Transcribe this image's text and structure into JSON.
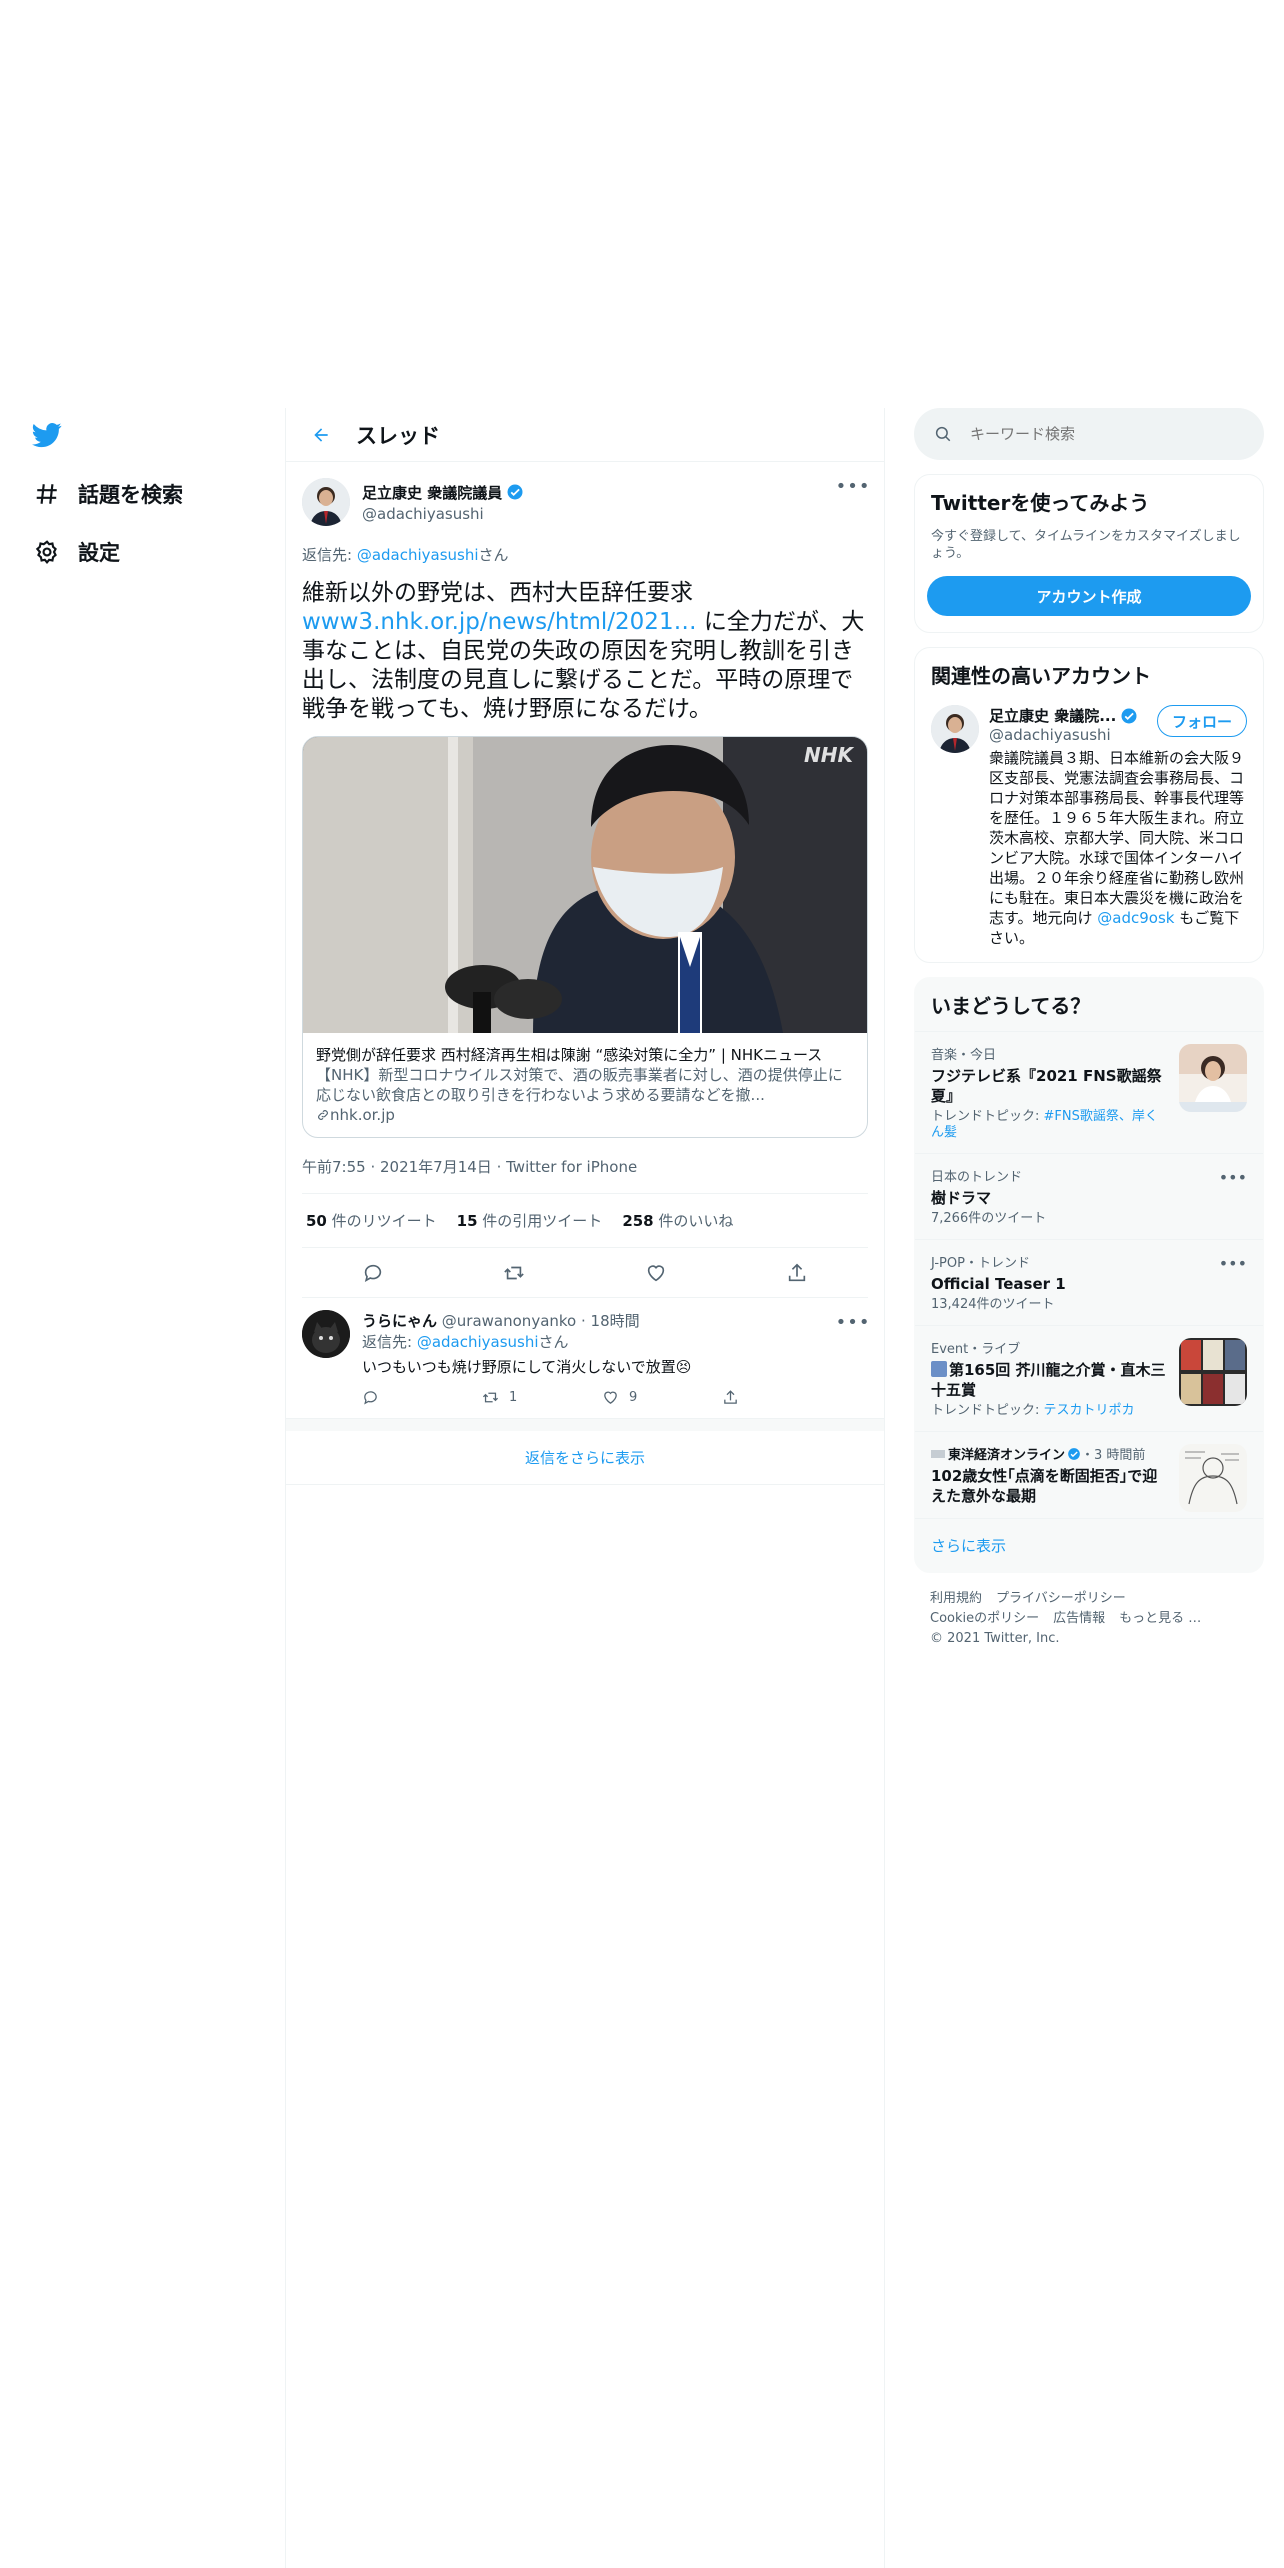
{
  "nav": {
    "explore_label": "話題を検索",
    "settings_label": "設定"
  },
  "header": {
    "title": "スレッド"
  },
  "tweet": {
    "author_name": "足立康史 衆議院議員",
    "author_handle": "@adachiyasushi",
    "reply_prefix": "返信先: ",
    "reply_handle": "@adachiyasushi",
    "reply_suffix": "さん",
    "text_before_link": "維新以外の野党は、西村大臣辞任要求",
    "link_text": "www3.nhk.or.jp/news/html/2021…",
    "text_after_link": " に全力だが、大事なことは、自民党の失政の原因を究明し教訓を引き出し、法制度の見直しに繋げることだ。平時の原理で戦争を戦っても、焼け野原になるだけ。",
    "card": {
      "title": "野党側が辞任要求 西村経済再生相は陳謝 “感染対策に全力” | NHKニュース",
      "description": "【NHK】新型コロナウイルス対策で、酒の販売事業者に対し、酒の提供停止に応じない飲食店との取り引きを行わないよう求める要請などを撤...",
      "domain": "nhk.or.jp",
      "watermark": "NHK"
    },
    "time": "午前7:55",
    "date": "2021年7月14日",
    "source": "Twitter for iPhone",
    "retweets_count": "50",
    "retweets_label": " 件のリツイート",
    "quotes_count": "15",
    "quotes_label": " 件の引用ツイート",
    "likes_count": "258",
    "likes_label": " 件のいいね"
  },
  "reply": {
    "name": "うらにゃん",
    "handle": "@urawanonyanko",
    "time": "18時間",
    "reply_prefix": "返信先: ",
    "reply_handle": "@adachiyasushi",
    "reply_suffix": "さん",
    "text": "いつもいつも焼け野原にして消火しないで放置😣",
    "retweet_count": "1",
    "like_count": "9"
  },
  "more_replies_label": "返信をさらに表示",
  "search": {
    "placeholder": "キーワード検索"
  },
  "signup": {
    "title": "Twitterを使ってみよう",
    "subtitle": "今すぐ登録して、タイムラインをカスタマイズしましょう。",
    "button": "アカウント作成"
  },
  "related": {
    "title": "関連性の高いアカウント",
    "name": "足立康史 衆議院...",
    "handle": "@adachiyasushi",
    "follow_label": "フォロー",
    "bio_before": "衆議院議員３期、日本維新の会大阪９区支部長、党憲法調査会事務局長、コロナ対策本部事務局長、幹事長代理等を歴任。１９６５年大阪生まれ。府立茨木高校、京都大学、同大院、米コロンビア大院。水球で国体インターハイ出場。２０年余り経産省に勤務し欧州にも駐在。東日本大震災を機に政治を志す。地元向け ",
    "bio_link": "@adc9osk",
    "bio_after": " もご覧下さい。"
  },
  "trends": {
    "title": "いまどうしてる？",
    "items": [
      {
        "category": "音楽・今日",
        "name": "フジテレビ系『2021 FNS歌謡祭 夏』",
        "sub_prefix": "トレンドトピック: ",
        "sub_link": "#FNS歌謡祭、岸くん髪"
      },
      {
        "category": "日本のトレンド",
        "name": "樹ドラマ",
        "sub": "7,266件のツイート"
      },
      {
        "category": "J-POP・トレンド",
        "name": "Official Teaser 1",
        "sub": "13,424件のツイート"
      },
      {
        "category": "Event・ライブ",
        "name": "第165回 芥川龍之介賞・直木三十五賞",
        "sub_prefix": "トレンドトピック: ",
        "sub_link": "テスカトリポカ"
      },
      {
        "category_name": "東洋経済オンライン",
        "category_time": "・3 時間前",
        "name": "102歳女性｢点滴を断固拒否｣で迎えた意外な最期"
      }
    ],
    "show_more": "さらに表示"
  },
  "footer": {
    "terms": "利用規約",
    "privacy": "プライバシーポリシー",
    "cookies": "Cookieのポリシー",
    "ads": "広告情報",
    "more": "もっと見る …",
    "copyright": "© 2021 Twitter, Inc."
  },
  "colors": {
    "accent": "#1d9bf0",
    "muted": "#536471",
    "border": "#eff3f4"
  }
}
